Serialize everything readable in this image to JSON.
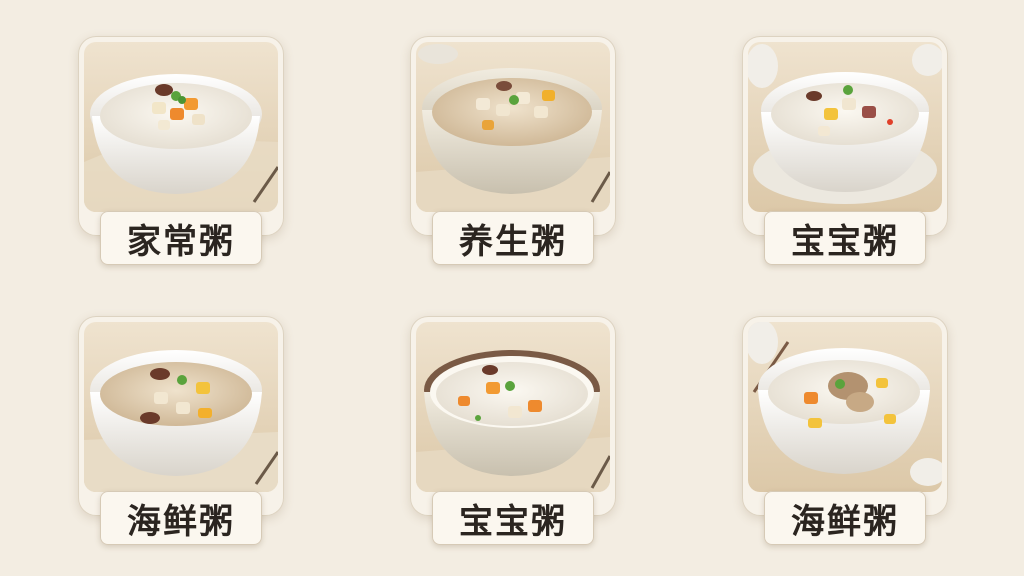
{
  "menu": {
    "items": [
      {
        "label": "家常粥",
        "image": "congee-bowl-image"
      },
      {
        "label": "养生粥",
        "image": "congee-bowl-image"
      },
      {
        "label": "宝宝粥",
        "image": "congee-bowl-image"
      },
      {
        "label": "海鲜粥",
        "image": "congee-bowl-image"
      },
      {
        "label": "宝宝粥",
        "image": "congee-bowl-image"
      },
      {
        "label": "海鲜粥",
        "image": "congee-bowl-image"
      }
    ]
  },
  "colors": {
    "background": "#f3ede2",
    "card": "#f7f2e9",
    "label_text": "#2b2520"
  }
}
